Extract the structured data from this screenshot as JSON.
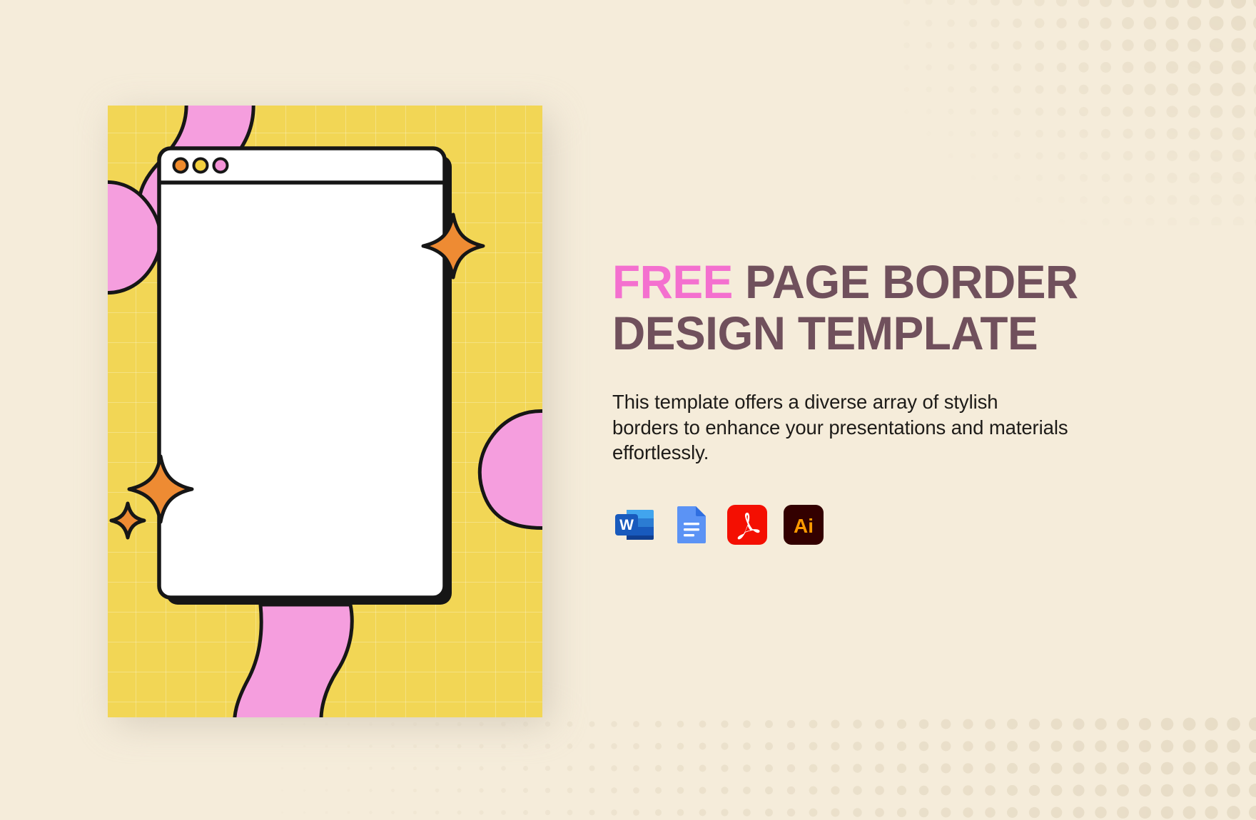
{
  "page": {
    "background_color": "#f5ecda",
    "dot_color": "#e7dcc6"
  },
  "poster": {
    "background_color": "#f2d655",
    "grid_color": "#ffffff",
    "ribbon_color": "#f59ede",
    "outline_color": "#161616",
    "window_fill": "#ffffff",
    "sparkle_color": "#ee8b33",
    "window": {
      "name": "browser-window-mockup",
      "dots": [
        {
          "name": "window-dot-orange",
          "color": "#ef8b2c"
        },
        {
          "name": "window-dot-yellow",
          "color": "#f2cf3e"
        },
        {
          "name": "window-dot-pink",
          "color": "#f492d8"
        }
      ]
    },
    "sparkles": [
      {
        "name": "sparkle-right-large"
      },
      {
        "name": "sparkle-bottom-left-large"
      },
      {
        "name": "sparkle-bottom-left-small"
      }
    ]
  },
  "copy": {
    "headline_highlight": "FREE",
    "headline_rest": " PAGE BORDER DESIGN TEMPLATE",
    "headline_full": "FREE PAGE BORDER DESIGN TEMPLATE",
    "highlight_color": "#f470cf",
    "headline_color": "#70505c",
    "description": "This template offers a diverse array of stylish borders to enhance your presentations and materials effortlessly."
  },
  "formats": [
    {
      "name": "microsoft-word-icon",
      "label": "Word",
      "letter": "W",
      "color": "#2b579a"
    },
    {
      "name": "google-docs-icon",
      "label": "Google Docs",
      "letter": "",
      "color": "#4285f4"
    },
    {
      "name": "pdf-icon",
      "label": "PDF",
      "letter": "",
      "color": "#f40f02"
    },
    {
      "name": "adobe-illustrator-icon",
      "label": "Illustrator",
      "letter": "Ai",
      "color": "#330000"
    }
  ]
}
